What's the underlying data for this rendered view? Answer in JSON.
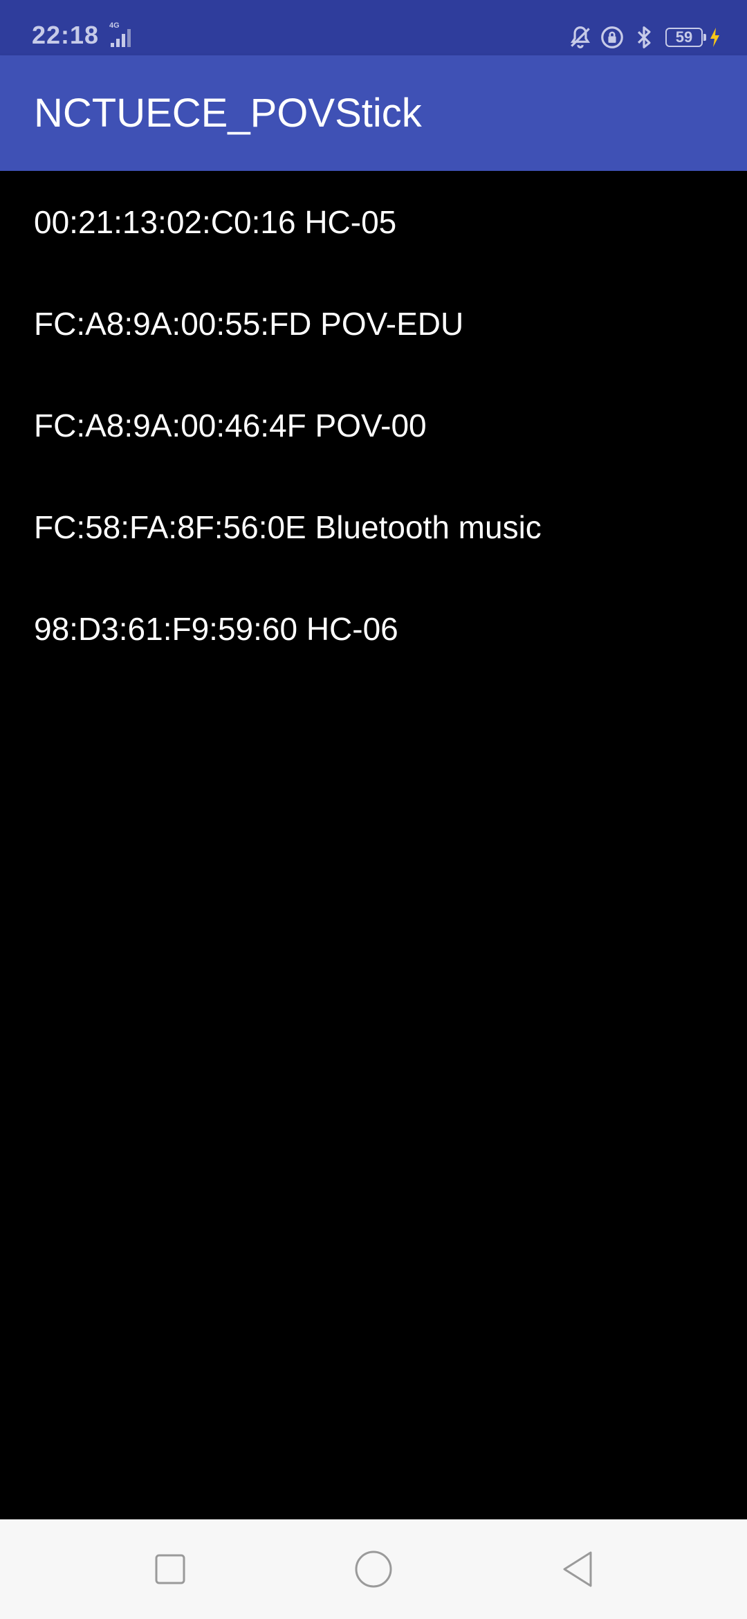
{
  "status_bar": {
    "time": "22:18",
    "network_label": "4G",
    "battery_level": "59",
    "icons": [
      "bell-off-icon",
      "rotation-lock-icon",
      "bluetooth-icon",
      "battery-icon",
      "charging-icon"
    ]
  },
  "app_bar": {
    "title": "NCTUECE_POVStick"
  },
  "devices": [
    {
      "label": "00:21:13:02:C0:16 HC-05"
    },
    {
      "label": "FC:A8:9A:00:55:FD POV-EDU"
    },
    {
      "label": "FC:A8:9A:00:46:4F POV-00"
    },
    {
      "label": "FC:58:FA:8F:56:0E Bluetooth music"
    },
    {
      "label": "98:D3:61:F9:59:60 HC-06"
    }
  ],
  "nav_bar": {
    "buttons": [
      "recents-square-icon",
      "home-circle-icon",
      "back-triangle-icon"
    ]
  },
  "colors": {
    "status_bar": "#2f3d9c",
    "app_bar": "#3f51b5",
    "background": "#000000",
    "nav_bar": "#f7f7f7",
    "charging": "#f5c518"
  }
}
